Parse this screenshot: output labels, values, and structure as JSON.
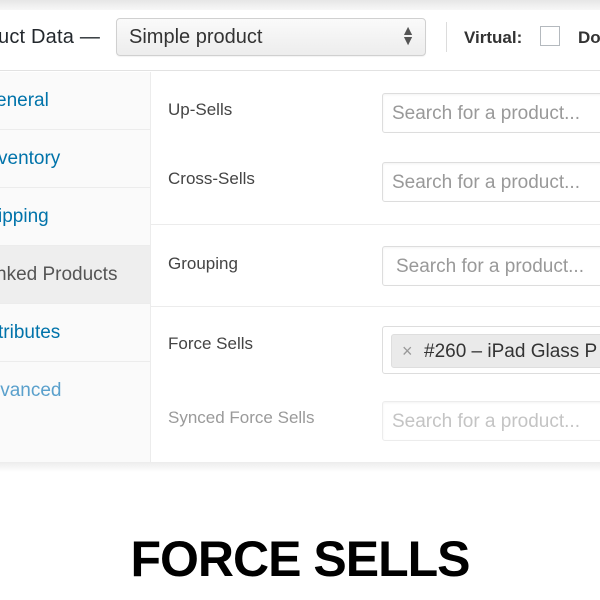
{
  "header": {
    "title": "uct Data —",
    "product_type": "Simple product",
    "virtual_label": "Virtual:",
    "downloadable_label": "Do"
  },
  "tabs": [
    {
      "label": "eneral",
      "active": false
    },
    {
      "label": "ventory",
      "active": false
    },
    {
      "label": "ipping",
      "active": false
    },
    {
      "label": "nked Products",
      "active": true
    },
    {
      "label": "tributes",
      "active": false
    },
    {
      "label": "lvanced",
      "active": false
    }
  ],
  "fields": {
    "upsells": {
      "label": "Up-Sells",
      "placeholder": "Search for a product..."
    },
    "crosssells": {
      "label": "Cross-Sells",
      "placeholder": "Search for a product..."
    },
    "grouping": {
      "label": "Grouping",
      "placeholder": "Search for a product..."
    },
    "force_sells": {
      "label": "Force Sells",
      "token_remove": "×",
      "token_text": "#260 – iPad Glass P"
    },
    "synced_force_sells": {
      "label": "Synced Force Sells",
      "placeholder": "Search for a product..."
    }
  },
  "icons": {
    "select_arrows": "up-down-arrows",
    "token_remove": "close-icon"
  },
  "caption": "FORCE SELLS",
  "colors": {
    "link": "#0073aa",
    "text": "#444444",
    "caption": "#000000"
  }
}
